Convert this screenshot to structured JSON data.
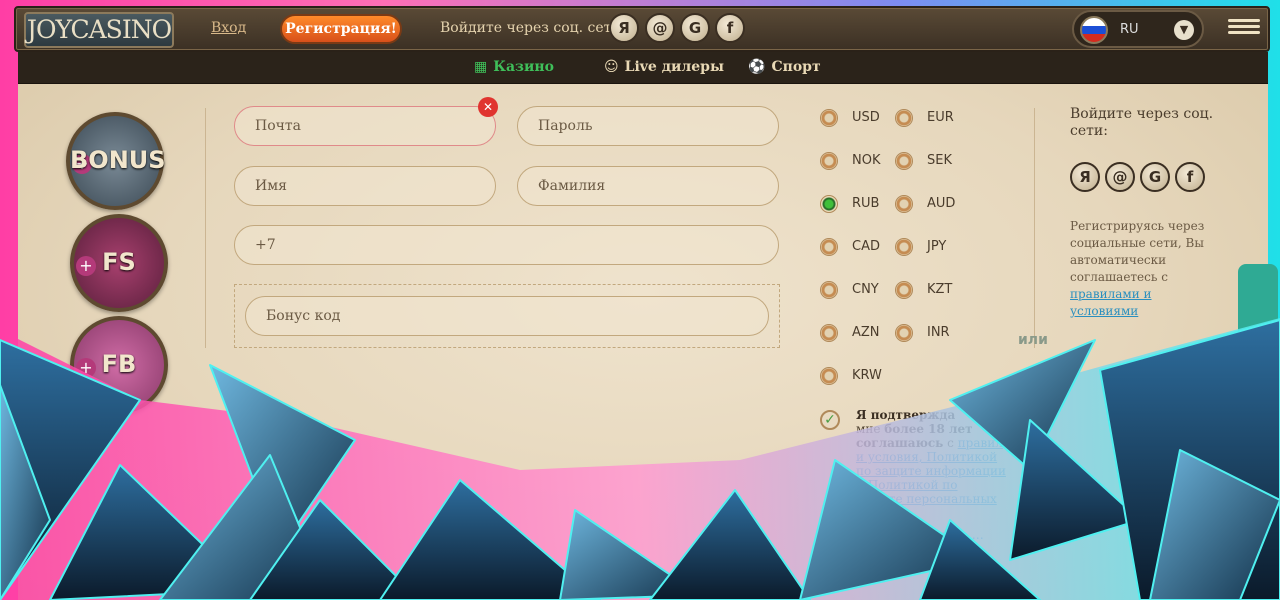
{
  "header": {
    "logo_text": "JOYCASINO",
    "login_label": "Вход",
    "register_label": "Регистрация!",
    "social_label": "Войдите через соц. сети:",
    "social_icons": [
      "Я",
      "@",
      "G",
      "f"
    ],
    "language": "RU",
    "menu_icon": "hamburger-menu-icon"
  },
  "nav": {
    "items": [
      {
        "label": "Казино",
        "icon": "slot-machine-icon",
        "color": "#3fbf5a"
      },
      {
        "label": "Live дилеры",
        "icon": "dealer-icon",
        "color": "#e9d9b5"
      },
      {
        "label": "Спорт",
        "icon": "soccer-ball-icon",
        "color": "#e9d9b5"
      }
    ]
  },
  "badges": [
    {
      "label": "BONUS",
      "prefix": "+",
      "color": "#5a6a78"
    },
    {
      "label": "FS",
      "prefix": "+",
      "color": "#8a2f5a"
    },
    {
      "label": "FB",
      "prefix": "+",
      "color": "#b04a86"
    }
  ],
  "form": {
    "email_placeholder": "Почта",
    "password_placeholder": "Пароль",
    "first_name_placeholder": "Имя",
    "last_name_placeholder": "Фамилия",
    "phone_value": "+7",
    "promo_placeholder": "Бонус код"
  },
  "currencies": [
    {
      "code": "USD",
      "selected": false
    },
    {
      "code": "EUR",
      "selected": false
    },
    {
      "code": "NOK",
      "selected": false
    },
    {
      "code": "SEK",
      "selected": false
    },
    {
      "code": "RUB",
      "selected": true
    },
    {
      "code": "AUD",
      "selected": false
    },
    {
      "code": "CAD",
      "selected": false
    },
    {
      "code": "JPY",
      "selected": false
    },
    {
      "code": "CNY",
      "selected": false
    },
    {
      "code": "KZT",
      "selected": false
    },
    {
      "code": "AZN",
      "selected": false
    },
    {
      "code": "INR",
      "selected": false
    },
    {
      "code": "KRW",
      "selected": false
    }
  ],
  "consent": {
    "l1_bold": "Я подтвержда",
    "l2_pre": "мне ",
    "l2_bold": "более 18 лет",
    "l3_bold": "соглашаюсь",
    "l3_pre": " с ",
    "l3_link": "правил",
    "links": "и условия, Политикой по защите информации и Политикой по защите персональных данных",
    "extra": "…ть информацию …через"
  },
  "or_label": "или",
  "side": {
    "title": "Войдите через соц. сети:",
    "icons": [
      "Я",
      "@",
      "G",
      "f"
    ],
    "note": "Регистрируясь через социальные сети, Вы автоматически соглашаетесь с",
    "note_link": "правилами и условиями"
  },
  "colors": {
    "accent_orange": "#e8641e",
    "selected_green": "#3fbf3a",
    "link_blue": "#2a8fbf",
    "error_red": "#e0342f"
  }
}
